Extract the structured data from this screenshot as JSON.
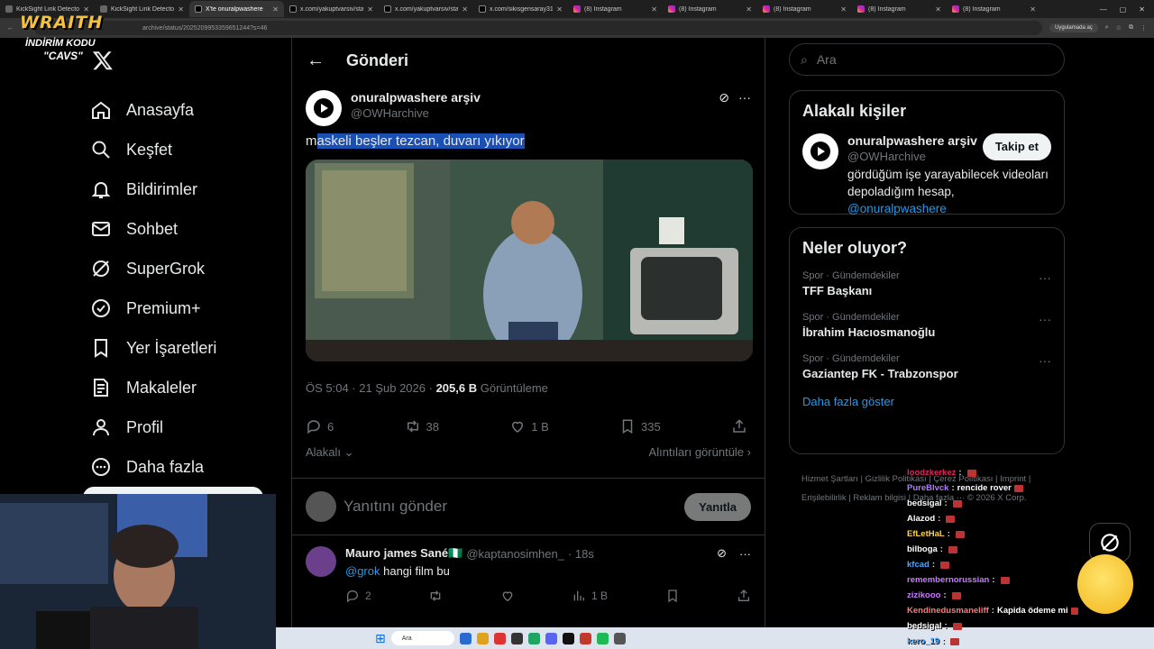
{
  "browser": {
    "tabs": [
      {
        "label": "KickSight Link Detector",
        "icon": "kick-icon"
      },
      {
        "label": "KickSight Link Detector",
        "icon": "kick-icon"
      },
      {
        "label": "X'te onuralpwashere",
        "icon": "x-icon",
        "active": true
      },
      {
        "label": "x.com/yakuptvarsiv/statu",
        "icon": "x-icon"
      },
      {
        "label": "x.com/yakuptvarsiv/statu",
        "icon": "x-icon"
      },
      {
        "label": "x.com/sikisgensaray31/st",
        "icon": "x-icon"
      },
      {
        "label": "(8) Instagram",
        "icon": "instagram-icon"
      },
      {
        "label": "(8) Instagram",
        "icon": "instagram-icon"
      },
      {
        "label": "(8) Instagram",
        "icon": "instagram-icon"
      },
      {
        "label": "(8) Instagram",
        "icon": "instagram-icon"
      },
      {
        "label": "(8) Instagram",
        "icon": "instagram-icon"
      }
    ],
    "url": "archive/status/2025209953359651244?s=46",
    "pill": "Uygulamada aç"
  },
  "overlay": {
    "brand": "WRAITH",
    "promo_line1": "İNDİRİM KODU",
    "promo_line2": "\"CAVS\""
  },
  "sidebar": {
    "items": [
      {
        "label": "Anasayfa",
        "icon": "home-icon"
      },
      {
        "label": "Keşfet",
        "icon": "search-icon"
      },
      {
        "label": "Bildirimler",
        "icon": "bell-icon"
      },
      {
        "label": "Sohbet",
        "icon": "mail-icon"
      },
      {
        "label": "SuperGrok",
        "icon": "grok-icon"
      },
      {
        "label": "Premium+",
        "icon": "verified-icon"
      },
      {
        "label": "Yer İşaretleri",
        "icon": "bookmark-icon"
      },
      {
        "label": "Makaleler",
        "icon": "article-icon"
      },
      {
        "label": "Profil",
        "icon": "person-icon"
      },
      {
        "label": "Daha fazla",
        "icon": "more-circle-icon"
      }
    ]
  },
  "main": {
    "title": "Gönderi",
    "tweet": {
      "name": "onuralpwashere arşiv",
      "handle": "@OWHarchive",
      "text_first": "m",
      "text_selected": "askeli beşler tezcan, duvarı yıkıyor",
      "time": "ÖS 5:04 · 21 Şub 2026 ·",
      "views": "205,6 B",
      "views_label": "Görüntüleme",
      "replies": "6",
      "retweets": "38",
      "likes": "1 B",
      "bookmarks": "335",
      "sort_label": "Alakalı",
      "quotes_label": "Alıntıları görüntüle"
    },
    "reply_placeholder": "Yanıtını gönder",
    "reply_button": "Yanıtla",
    "replies": [
      {
        "name": "Mauro james Sané🇳🇬",
        "handle": "@kaptanosimhen_",
        "time": "· 18s",
        "mention": "@grok",
        "text": " hangi film bu",
        "replies": "2",
        "views": "1 B"
      }
    ]
  },
  "right": {
    "search_placeholder": "Ara",
    "related": {
      "title": "Alakalı kişiler",
      "name": "onuralpwashere arşiv",
      "handle": "@OWHarchive",
      "bio": "gördüğüm işe yarayabilecek videoları depoladığım hesap, ",
      "bio_mention": "@onuralpwashere",
      "follow": "Takip et"
    },
    "trends": {
      "title": "Neler oluyor?",
      "items": [
        {
          "category": "Spor · Gündemdekiler",
          "name": "TFF Başkanı"
        },
        {
          "category": "Spor · Gündemdekiler",
          "name": "İbrahim Hacıosmanoğlu"
        },
        {
          "category": "Spor · Gündemdekiler",
          "name": "Gaziantep FK - Trabzonspor"
        }
      ],
      "more": "Daha fazla göster"
    },
    "footer": "Hizmet Şartları  |  Gizlilik Politikası  |  Çerez Politikası  |  Imprint  |  Erişilebilirlik  |  Reklam bilgisi  |  Daha fazla ···  © 2026 X Corp."
  },
  "chat": [
    {
      "user": "loodzkerkez",
      "color": "#e0245e",
      "msg": ""
    },
    {
      "user": "PureBlvck",
      "color": "#b57bff",
      "msg": "rencide rover"
    },
    {
      "user": "bedsigal",
      "color": "#ffffff",
      "msg": ""
    },
    {
      "user": "Alazod",
      "color": "#ffffff",
      "msg": ""
    },
    {
      "user": "EfLetHaL",
      "color": "#ffd34d",
      "msg": ""
    },
    {
      "user": "bilboga",
      "color": "#ffffff",
      "msg": ""
    },
    {
      "user": "kfcad",
      "color": "#4ea8ff",
      "msg": ""
    },
    {
      "user": "remembernorussian",
      "color": "#c87bff",
      "msg": ""
    },
    {
      "user": "zizikooo",
      "color": "#c87bff",
      "msg": ""
    },
    {
      "user": "Kendinedusmaneliff",
      "color": "#ff7a7a",
      "msg": "Kapida ödeme mi"
    },
    {
      "user": "bedsigal",
      "color": "#ffffff",
      "msg": ""
    },
    {
      "user": "kero_19",
      "color": "#4ea8ff",
      "msg": ""
    }
  ],
  "taskbar": {
    "search": "Ara"
  }
}
